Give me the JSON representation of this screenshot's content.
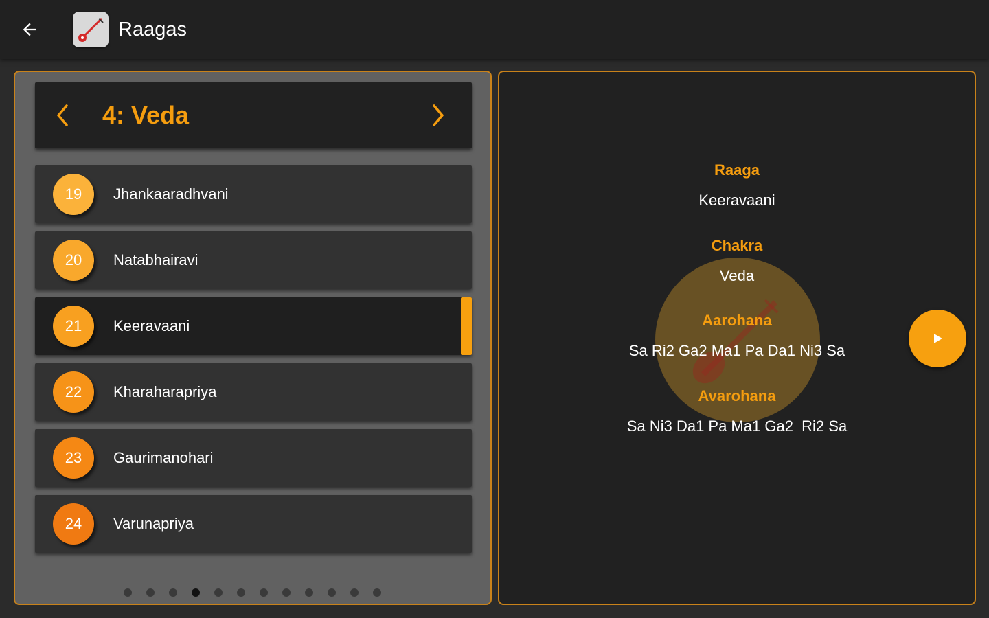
{
  "appbar": {
    "title": "Raagas",
    "back_icon": "arrow-left-icon",
    "app_icon": "veena-icon"
  },
  "chakra": {
    "title": "4: Veda",
    "prev_icon": "chevron-left-icon",
    "next_icon": "chevron-right-icon"
  },
  "raagas": [
    {
      "num": "19",
      "name": "Jhankaaradhvani",
      "color": "#fbb23a"
    },
    {
      "num": "20",
      "name": "Natabhairavi",
      "color": "#f9a82c"
    },
    {
      "num": "21",
      "name": "Keeravaani",
      "color": "#f8a020",
      "selected": true
    },
    {
      "num": "22",
      "name": "Kharaharapriya",
      "color": "#f69318"
    },
    {
      "num": "23",
      "name": "Gaurimanohari",
      "color": "#f58814"
    },
    {
      "num": "24",
      "name": "Varunapriya",
      "color": "#f07a12"
    }
  ],
  "pager": {
    "count": 12,
    "active_index": 3
  },
  "details": {
    "raaga_label": "Raaga",
    "raaga_value": "Keeravaani",
    "chakra_label": "Chakra",
    "chakra_value": "Veda",
    "aarohana_label": "Aarohana",
    "aarohana_value": "Sa Ri2 Ga2 Ma1 Pa Da1 Ni3 Sa",
    "avarohana_label": "Avarohana",
    "avarohana_value": "Sa Ni3 Da1 Pa Ma1 Ga2  Ri2 Sa",
    "play_icon": "play-icon"
  },
  "colors": {
    "accent": "#f7a00f",
    "border": "#c9821a",
    "appbar": "#212121",
    "panel_left": "#616161",
    "panel_right": "#212121"
  }
}
